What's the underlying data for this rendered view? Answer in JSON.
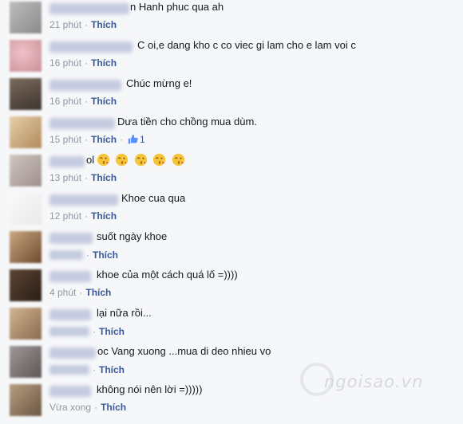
{
  "comments": [
    {
      "text": "n Hanh phuc qua ah",
      "time": "21 phút",
      "like": "Thích"
    },
    {
      "text": "C oi,e dang kho c co viec gi lam cho e lam voi c",
      "time": "16 phút",
      "like": "Thích"
    },
    {
      "text": "Chúc mừng e!",
      "time": "16 phút",
      "like": "Thích"
    },
    {
      "text": "Dưa tiền cho chồng mua dùm.",
      "time": "15 phút",
      "like": "Thích",
      "like_count": "1"
    },
    {
      "text": "ol",
      "time": "13 phút",
      "like": "Thích",
      "emoji_count": 5
    },
    {
      "text": "Khoe cua qua",
      "time": "12 phút",
      "like": "Thích"
    },
    {
      "text": "suốt ngày khoe",
      "time": "",
      "like": "Thích"
    },
    {
      "text": "khoe của một cách quá lố =))))",
      "time": "4 phút",
      "like": "Thích"
    },
    {
      "text": "lại nữa rồi...",
      "time": "",
      "like": "Thích"
    },
    {
      "text": "oc Vang xuong ...mua di deo nhieu vo",
      "time": "",
      "like": "Thích"
    },
    {
      "text": "không nói nên lời =)))))",
      "time": "Vừa xong",
      "like": "Thích"
    }
  ],
  "watermark": {
    "text": "ngoisao.vn"
  },
  "colors": {
    "link": "#3b5998",
    "meta": "#9197a3",
    "text": "#141823",
    "background": "#f6f7f9"
  },
  "icons": {
    "like_count": "thumbs-up-icon",
    "emoji": "kiss-face-emoji-icon"
  }
}
